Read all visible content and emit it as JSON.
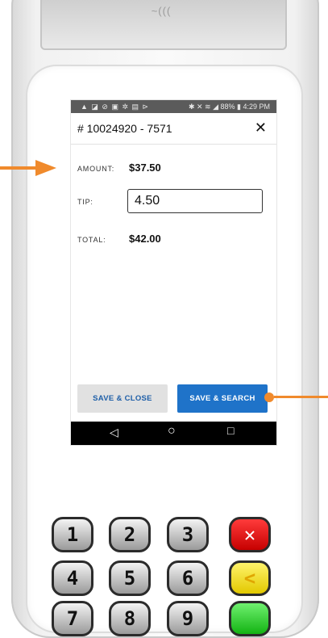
{
  "status_bar": {
    "left_icons": "▲ ◪ ⊘ ▣ ✲ ▤ ⊳",
    "right_text": "✱ ✕ ≋ ◢ 88% ▮ 4:29 PM"
  },
  "header": {
    "title": "# 10024920 - 7571",
    "close_glyph": "✕"
  },
  "fields": {
    "amount_label": "AMOUNT:",
    "amount_value": "$37.50",
    "tip_label": "TIP:",
    "tip_value": "4.50",
    "total_label": "TOTAL:",
    "total_value": "$42.00"
  },
  "buttons": {
    "save_close": "SAVE & CLOSE",
    "save_search": "SAVE & SEARCH"
  },
  "nav": {
    "back": "◁",
    "home": "○",
    "recent": "□"
  },
  "device": {
    "nfc_logo": "~((("
  },
  "keypad": {
    "keys": [
      "1",
      "2",
      "3",
      "✕",
      "4",
      "5",
      "6",
      "<",
      "7",
      "8",
      "9",
      ""
    ]
  },
  "colors": {
    "accent_orange": "#f08a2c",
    "primary_blue": "#1f73c9",
    "status_gray": "#5b5b5b"
  }
}
